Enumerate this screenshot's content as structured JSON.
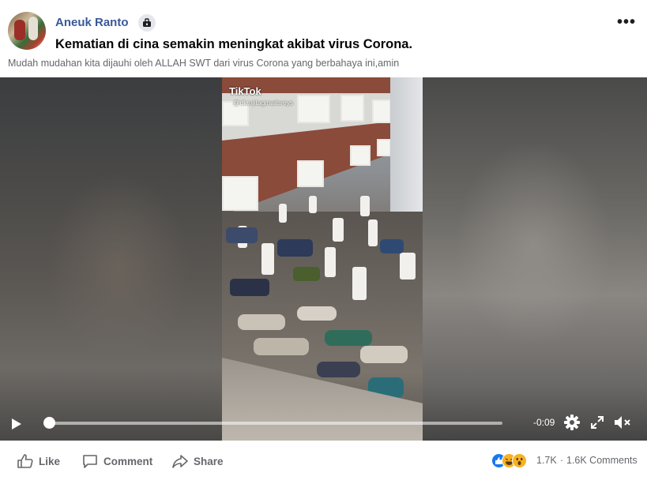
{
  "post": {
    "author": "Aneuk Ranto",
    "title": "Kematian di cina semakin meningkat akibat virus Corona.",
    "caption": "Mudah mudahan kita dijauhi oleh ALLAH SWT dari virus Corona yang berbahaya ini,amin"
  },
  "video": {
    "watermark": "TikTok",
    "watermark_user": "@dianjitagmailsreys",
    "time_remaining": "-0:09",
    "progress": 0.0
  },
  "actions": {
    "like": "Like",
    "comment": "Comment",
    "share": "Share"
  },
  "stats": {
    "reactions_count": "1.7K",
    "separator": "·",
    "comments_count": "1.6K Comments"
  },
  "colors": {
    "author": "#385898",
    "secondary_text": "#65676b",
    "like_reaction": "#1877f2",
    "haha_reaction": "#f7b125"
  }
}
